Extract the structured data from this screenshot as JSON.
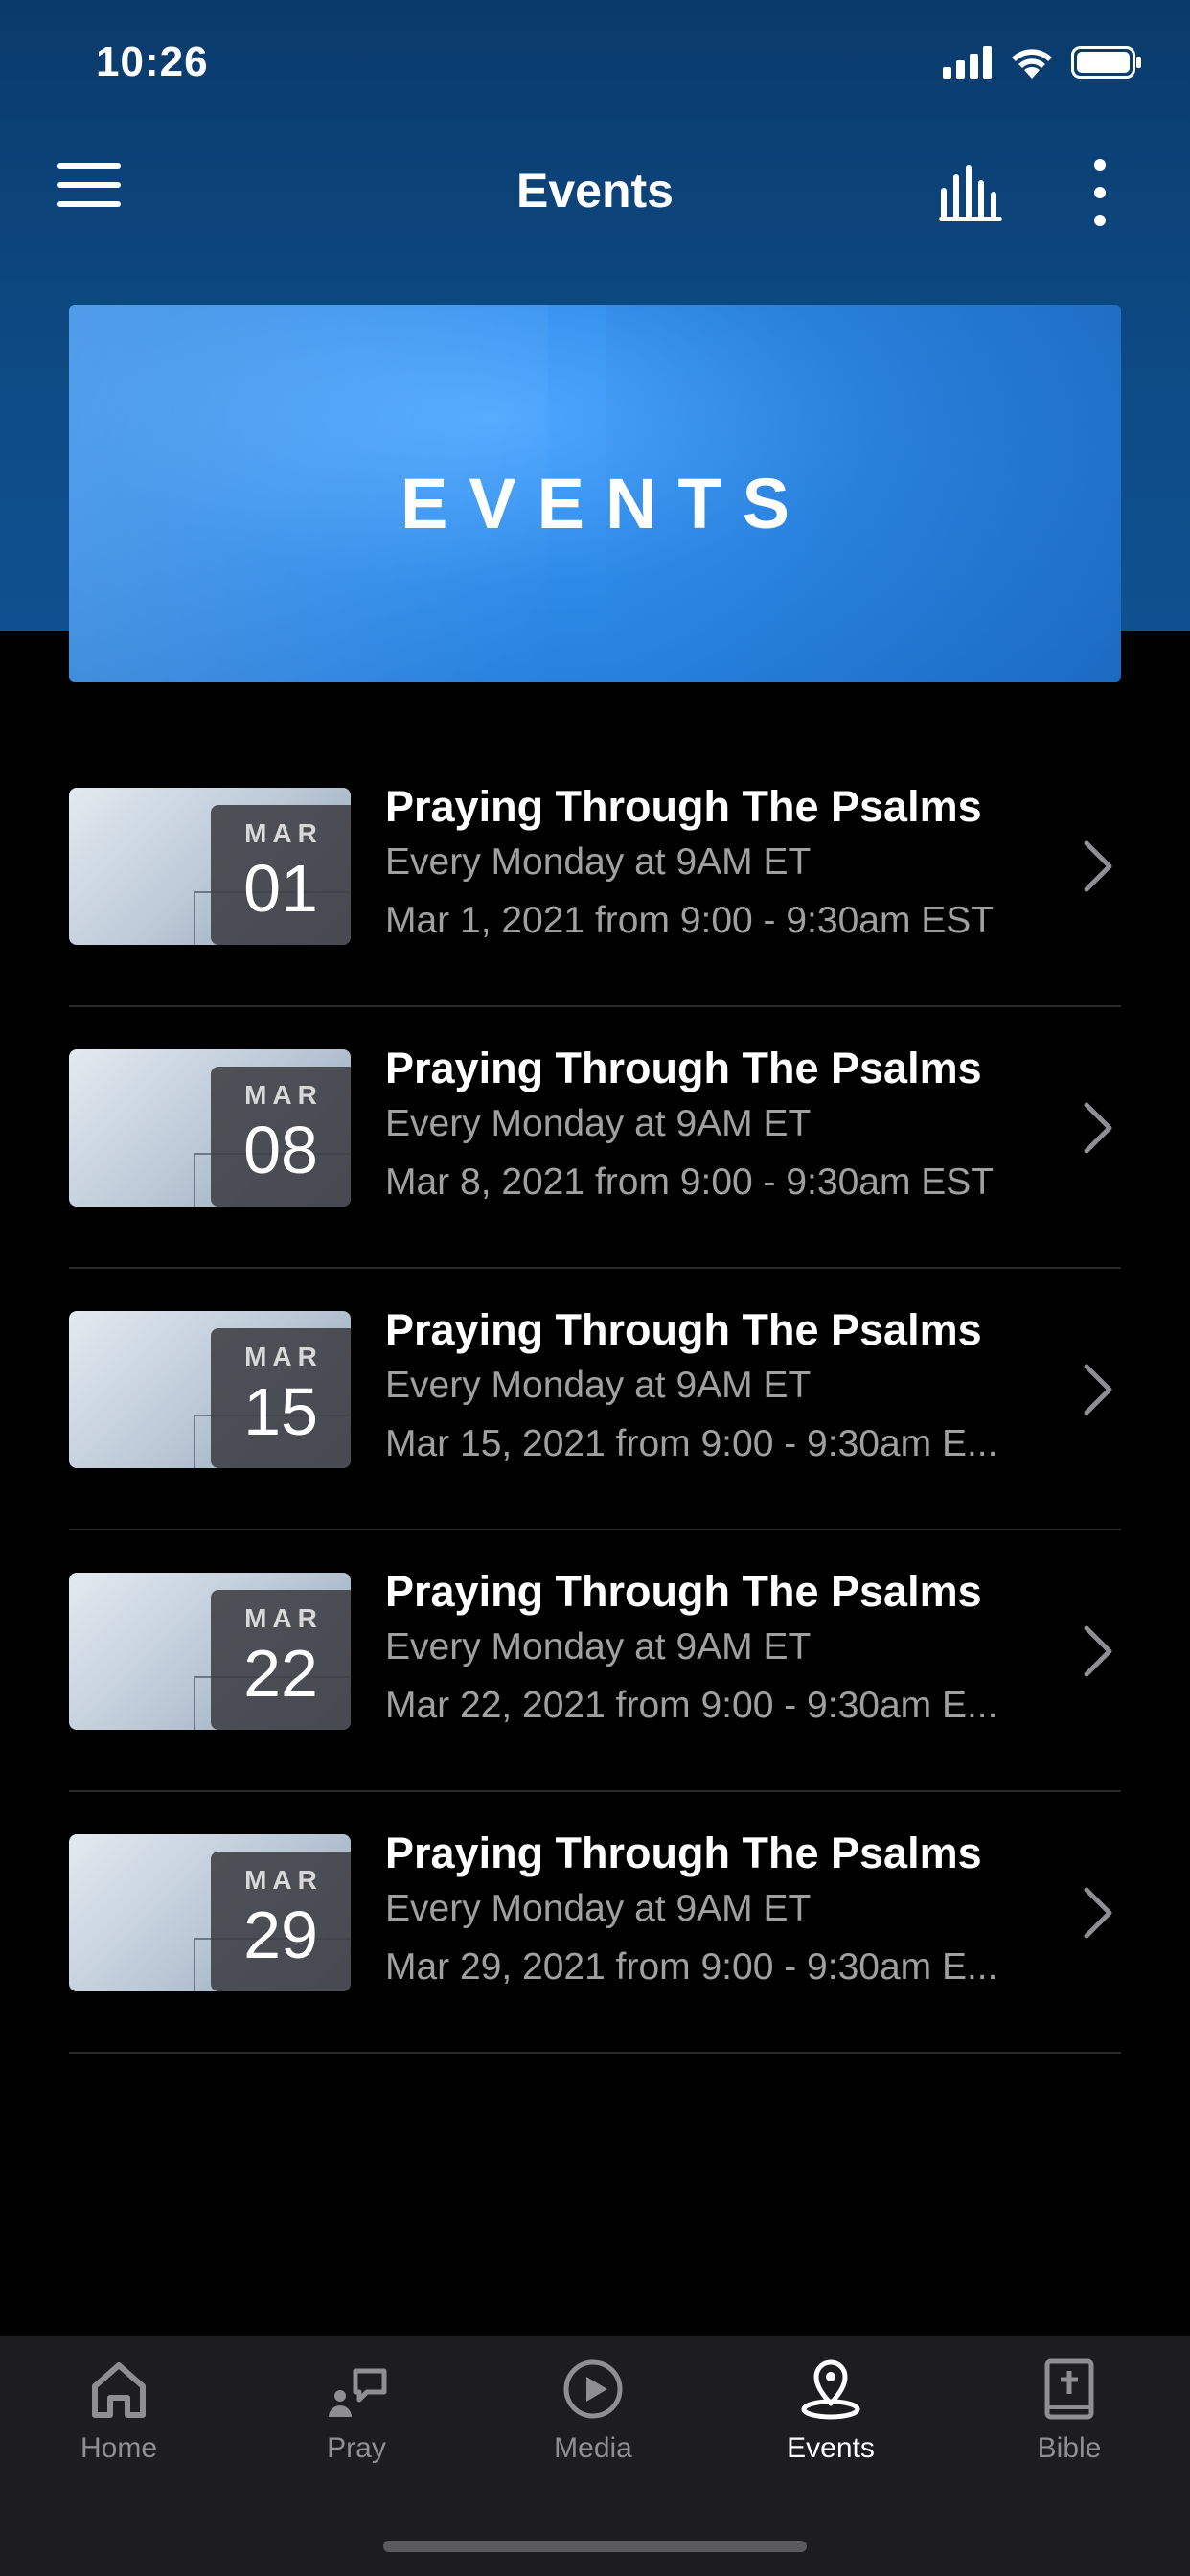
{
  "status_bar": {
    "time": "10:26"
  },
  "nav": {
    "title": "Events"
  },
  "banner": {
    "text": "EVENTS"
  },
  "events": [
    {
      "month": "MAR",
      "day": "01",
      "title": "Praying Through The Psalms",
      "subtitle": "Every Monday at 9AM ET",
      "date_text": "Mar 1, 2021 from 9:00 - 9:30am EST"
    },
    {
      "month": "MAR",
      "day": "08",
      "title": "Praying Through The Psalms",
      "subtitle": "Every Monday at 9AM ET",
      "date_text": "Mar 8, 2021 from 9:00 - 9:30am EST"
    },
    {
      "month": "MAR",
      "day": "15",
      "title": "Praying Through The Psalms",
      "subtitle": "Every Monday at 9AM ET",
      "date_text": "Mar 15, 2021 from 9:00 - 9:30am E..."
    },
    {
      "month": "MAR",
      "day": "22",
      "title": "Praying Through The Psalms",
      "subtitle": "Every Monday at 9AM ET",
      "date_text": "Mar 22, 2021 from 9:00 - 9:30am E..."
    },
    {
      "month": "MAR",
      "day": "29",
      "title": "Praying Through The Psalms",
      "subtitle": "Every Monday at 9AM ET",
      "date_text": "Mar 29, 2021 from 9:00 - 9:30am E..."
    }
  ],
  "tabs": [
    {
      "label": "Home",
      "icon": "home-icon",
      "active": false
    },
    {
      "label": "Pray",
      "icon": "pray-icon",
      "active": false
    },
    {
      "label": "Media",
      "icon": "play-circle-icon",
      "active": false
    },
    {
      "label": "Events",
      "icon": "map-pin-icon",
      "active": true
    },
    {
      "label": "Bible",
      "icon": "bible-icon",
      "active": false
    }
  ],
  "colors": {
    "header_blue": "#0d4b85",
    "banner_blue": "#2d8ae8",
    "background": "#000000",
    "tab_bar": "#1d1d1f",
    "inactive_tab": "#8e8e93"
  }
}
